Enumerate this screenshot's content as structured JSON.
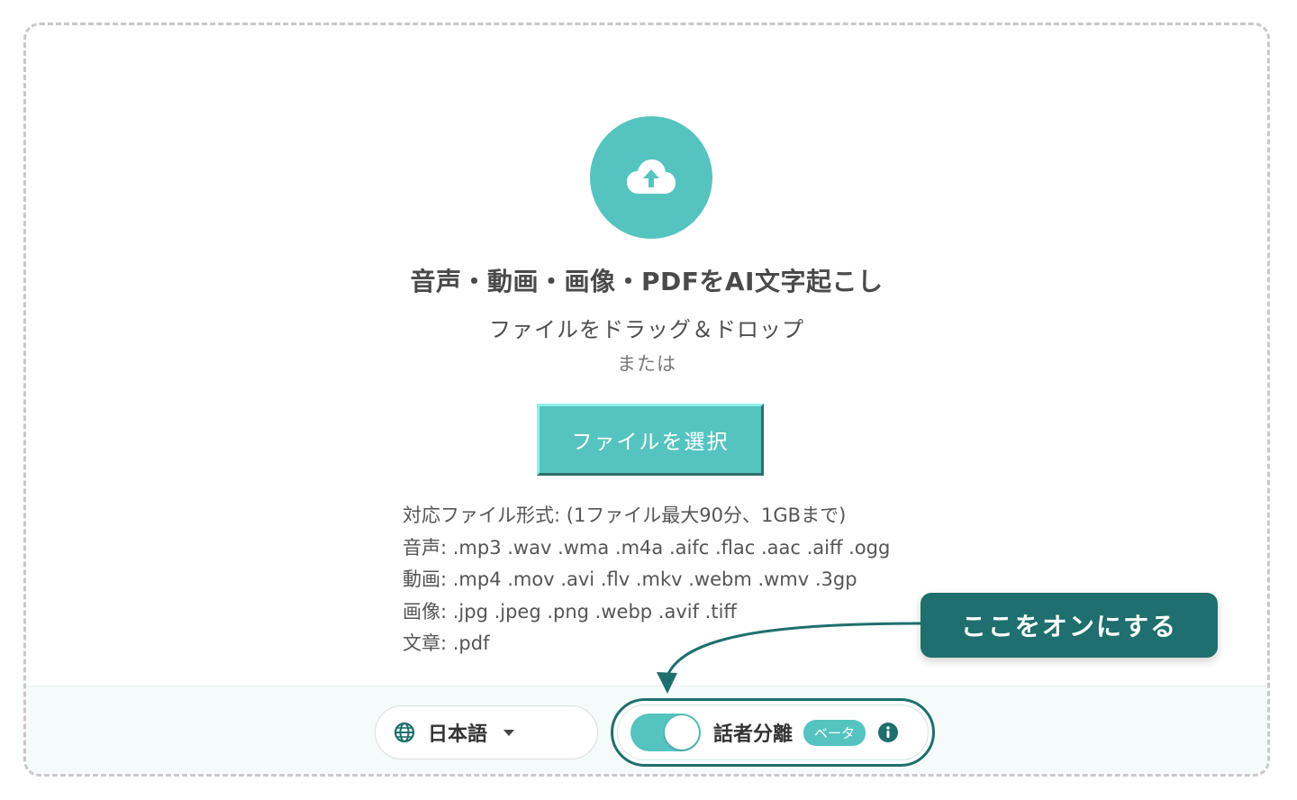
{
  "upload": {
    "headline": "音声・動画・画像・PDFをAI文字起こし",
    "drag_text": "ファイルをドラッグ＆ドロップ",
    "or_text": "または",
    "select_button_label": "ファイルを選択",
    "icon": "cloud-upload-icon"
  },
  "formats": {
    "header": "対応ファイル形式: (1ファイル最大90分、1GBまで)",
    "audio": "音声: .mp3 .wav .wma .m4a .aifc .flac .aac .aiff .ogg",
    "video": "動画: .mp4 .mov .avi .flv .mkv .webm .wmv .3gp",
    "image": "画像: .jpg .jpeg .png .webp .avif .tiff",
    "document": "文章: .pdf"
  },
  "language": {
    "selected": "日本語",
    "icon": "globe-icon"
  },
  "diarization": {
    "label": "話者分離",
    "badge": "ベータ",
    "enabled": true,
    "info_icon": "info-icon"
  },
  "callout": {
    "text": "ここをオンにする"
  },
  "colors": {
    "accent": "#55c4c1",
    "dark_teal": "#1e6f6d",
    "text": "#4a4a4a"
  }
}
